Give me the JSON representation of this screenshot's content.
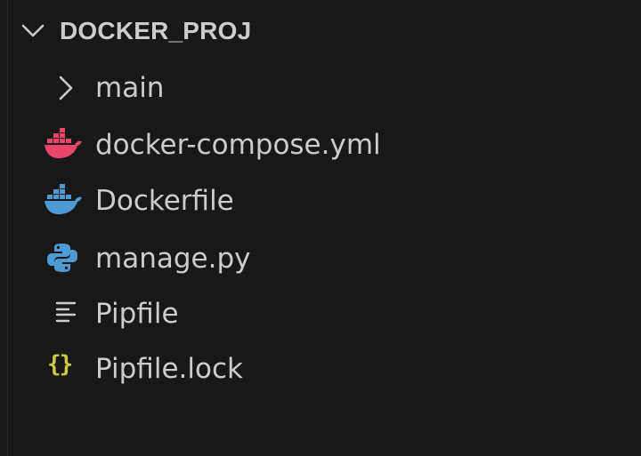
{
  "explorer": {
    "folder": {
      "name": "DOCKER_PROJ",
      "expanded": true
    },
    "items": [
      {
        "label": "main",
        "kind": "folder",
        "icon": "chevron-right-icon"
      },
      {
        "label": "docker-compose.yml",
        "kind": "file",
        "icon": "docker-whale-icon",
        "icon_color": "#e8466b"
      },
      {
        "label": "Dockerfile",
        "kind": "file",
        "icon": "docker-whale-icon",
        "icon_color": "#4d9ad4"
      },
      {
        "label": "manage.py",
        "kind": "file",
        "icon": "python-icon",
        "icon_color": "#4d9ad4"
      },
      {
        "label": "Pipfile",
        "kind": "file",
        "icon": "lines-text-icon",
        "icon_color": "#cccccc"
      },
      {
        "label": "Pipfile.lock",
        "kind": "file",
        "icon": "json-braces-icon",
        "icon_color": "#cbcb41"
      }
    ]
  },
  "colors": {
    "background": "#181818",
    "text": "#cccccc"
  }
}
